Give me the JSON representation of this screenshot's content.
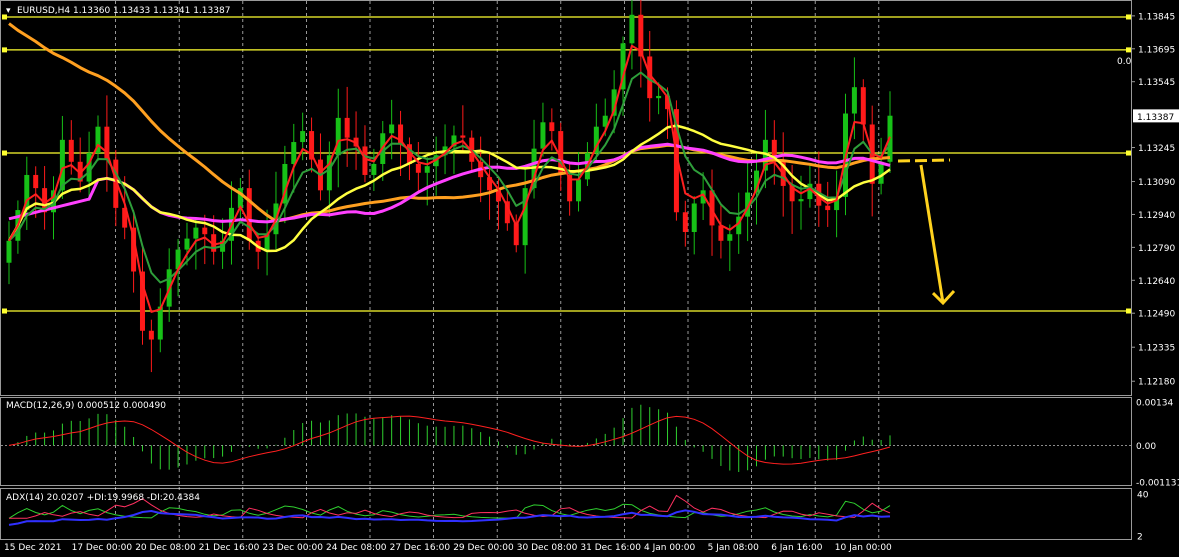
{
  "chart_data": [
    {
      "type": "candlestick",
      "symbol": "EURUSD",
      "timeframe": "H4",
      "header": "EURUSD,H4  1.13360 1.13433 1.13341 1.13387",
      "ohlc": {
        "open": "1.13360",
        "high": "1.13433",
        "low": "1.13341",
        "close": "1.13387"
      },
      "current_price": "1.13387",
      "ylim": [
        1.1214,
        1.1389
      ],
      "yticks": [
        "1.13845",
        "1.13695",
        "1.13545",
        "1.13387",
        "1.13245",
        "1.13090",
        "1.12940",
        "1.12790",
        "1.12640",
        "1.12490",
        "1.12335",
        "1.12180"
      ],
      "x_tick_labels": [
        "15 Dec 2021",
        "17 Dec 00:00",
        "20 Dec 08:00",
        "21 Dec 16:00",
        "23 Dec 00:00",
        "24 Dec 08:00",
        "27 Dec 16:00",
        "29 Dec 00:00",
        "30 Dec 08:00",
        "31 Dec 16:00",
        "4 Jan 00:00",
        "5 Jan 08:00",
        "6 Jan 16:00",
        "10 Jan 00:00"
      ],
      "horizontal_levels": [
        1.1384,
        1.1369,
        1.1322,
        1.125
      ],
      "level_label": "0.0",
      "candles_close": [
        1.1282,
        1.1296,
        1.1312,
        1.1306,
        1.1295,
        1.1305,
        1.1328,
        1.1318,
        1.1309,
        1.1322,
        1.1334,
        1.1319,
        1.1297,
        1.1288,
        1.1268,
        1.1241,
        1.1237,
        1.1252,
        1.1269,
        1.1278,
        1.1283,
        1.1288,
        1.1285,
        1.1277,
        1.1282,
        1.1297,
        1.1306,
        1.1282,
        1.1277,
        1.1285,
        1.1299,
        1.1317,
        1.1327,
        1.1332,
        1.1319,
        1.1305,
        1.1321,
        1.1338,
        1.1329,
        1.1325,
        1.1312,
        1.1317,
        1.1331,
        1.1335,
        1.1326,
        1.1317,
        1.1313,
        1.1316,
        1.1321,
        1.1325,
        1.133,
        1.1329,
        1.1318,
        1.1311,
        1.1305,
        1.13,
        1.129,
        1.128,
        1.1306,
        1.1324,
        1.1336,
        1.1332,
        1.1312,
        1.13,
        1.131,
        1.1322,
        1.1334,
        1.1339,
        1.1351,
        1.1372,
        1.1385,
        1.1366,
        1.1347,
        1.1348,
        1.1342,
        1.1295,
        1.1286,
        1.1299,
        1.1305,
        1.1289,
        1.1282,
        1.1285,
        1.1293,
        1.1304,
        1.1314,
        1.1328,
        1.1319,
        1.1307,
        1.13,
        1.1301,
        1.1308,
        1.1298,
        1.1296,
        1.1302,
        1.134,
        1.1352,
        1.1335,
        1.1308,
        1.1318,
        1.1339
      ],
      "indicators": [
        {
          "name": "green-ma",
          "color": "#2e9e3a"
        },
        {
          "name": "red-ma",
          "color": "#ff2020"
        },
        {
          "name": "yellow-ma",
          "color": "#ffff40"
        },
        {
          "name": "magenta-ma",
          "color": "#ff40ff"
        },
        {
          "name": "orange-ma",
          "color": "#ffa020"
        }
      ],
      "annotation": "projected move down to 1.12490",
      "colors": {
        "bull": "#17c117",
        "bear": "#ff1a1a",
        "level": "#ffff30",
        "arrow": "#ffd21e",
        "grid": "#ffffff"
      }
    },
    {
      "type": "histogram-line",
      "title": "MACD(12,26,9) 0.000512 0.000490",
      "yticks": [
        "0.00134",
        "0.00",
        "-0.001131"
      ],
      "ylim": [
        -0.00113,
        0.00134
      ],
      "colors": {
        "histogram": "#2fd02f",
        "signal": "#ff2020"
      }
    },
    {
      "type": "line",
      "title": "ADX(14) 20.0207 +DI:19.9968 -DI:20.4384",
      "yticks": [
        "40",
        "2"
      ],
      "ylim": [
        2,
        40
      ],
      "series": [
        {
          "name": "ADX",
          "color": "#3030ff"
        },
        {
          "name": "+DI",
          "color": "#2fd02f"
        },
        {
          "name": "-DI",
          "color": "#ff3060"
        }
      ]
    }
  ]
}
